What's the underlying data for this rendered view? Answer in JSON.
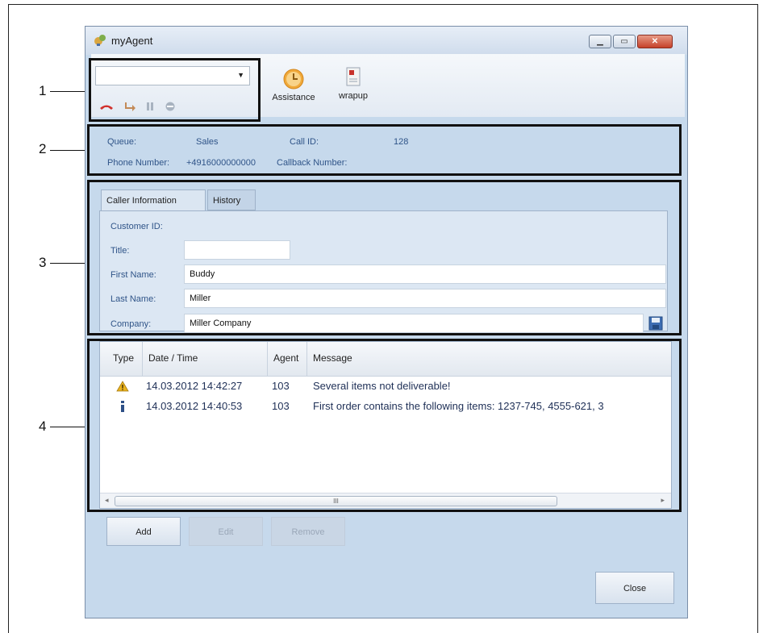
{
  "window": {
    "title": "myAgent"
  },
  "callouts": [
    "1",
    "2",
    "3",
    "4"
  ],
  "toolbar": {
    "phone_select": {
      "value": ""
    },
    "call_icons": [
      "hangup-icon",
      "transfer-icon",
      "hold-icon",
      "stop-icon"
    ],
    "assistance_label": "Assistance",
    "wrapup_label": "wrapup"
  },
  "call_info": {
    "queue_label": "Queue:",
    "queue_value": "Sales",
    "call_id_label": "Call ID:",
    "call_id_value": "128",
    "phone_label": "Phone Number:",
    "phone_value": "+4916000000000",
    "callback_label": "Callback Number:",
    "callback_value": ""
  },
  "tabs": [
    {
      "label": "Caller Information",
      "active": true
    },
    {
      "label": "History",
      "active": false
    }
  ],
  "caller": {
    "customer_id_label": "Customer ID:",
    "customer_id_value": "",
    "title_label": "Title:",
    "title_value": "",
    "first_name_label": "First Name:",
    "first_name_value": "Buddy",
    "last_name_label": "Last Name:",
    "last_name_value": "Miller",
    "company_label": "Company:",
    "company_value": "Miller Company"
  },
  "grid": {
    "columns": [
      "Type",
      "Date / Time",
      "Agent",
      "Message"
    ],
    "rows": [
      {
        "type": "warning-icon",
        "datetime": "14.03.2012 14:42:27",
        "agent": "103",
        "message": "Several items not deliverable!"
      },
      {
        "type": "info-icon",
        "datetime": "14.03.2012 14:40:53",
        "agent": "103",
        "message": "First order contains the following items: 1237-745, 4555-621, 3"
      }
    ],
    "scroll_thumb_glyph": "III"
  },
  "actions": {
    "add": "Add",
    "edit": "Edit",
    "remove": "Remove",
    "close": "Close"
  },
  "colors": {
    "window_bg": "#c6d9ec",
    "label_blue": "#2f5488",
    "callout_box": "#111111"
  }
}
